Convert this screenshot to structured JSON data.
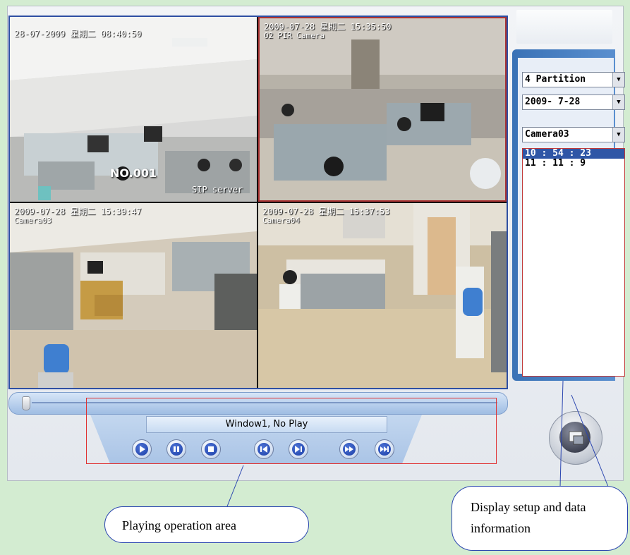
{
  "tiles": [
    {
      "osd": "28-07-2009 星期二 08:40:50",
      "sub": "",
      "overlay_num": "NO.001",
      "overlay_server": "SIP server"
    },
    {
      "osd": "2009-07-28 星期二 15:35:50",
      "sub": "02 PIR Camera"
    },
    {
      "osd": "2009-07-28 星期二 15:39:47",
      "sub": "Camera03"
    },
    {
      "osd": "2009-07-28 星期二 15:37:53",
      "sub": "Camera04"
    }
  ],
  "side_panel": {
    "partition": "4 Partition",
    "date": "2009- 7-28",
    "camera": "Camera03",
    "times": [
      "10 : 54 : 23",
      "11 : 11 : 9"
    ]
  },
  "player": {
    "status": "Window1, No Play",
    "seek_progress": 0.0,
    "buttons": [
      "play-icon",
      "pause-icon",
      "stop-icon",
      "prev-frame-icon",
      "next-frame-icon",
      "fast-forward-icon",
      "skip-forward-icon"
    ]
  },
  "callouts": {
    "playing": "Playing operation area",
    "display": "Display setup and data information"
  },
  "colors": {
    "panel_blue": "#3a72b6",
    "button_blue": "#1b3ea6",
    "annotation_red": "#e03030",
    "page_green": "#d3ecd1"
  }
}
